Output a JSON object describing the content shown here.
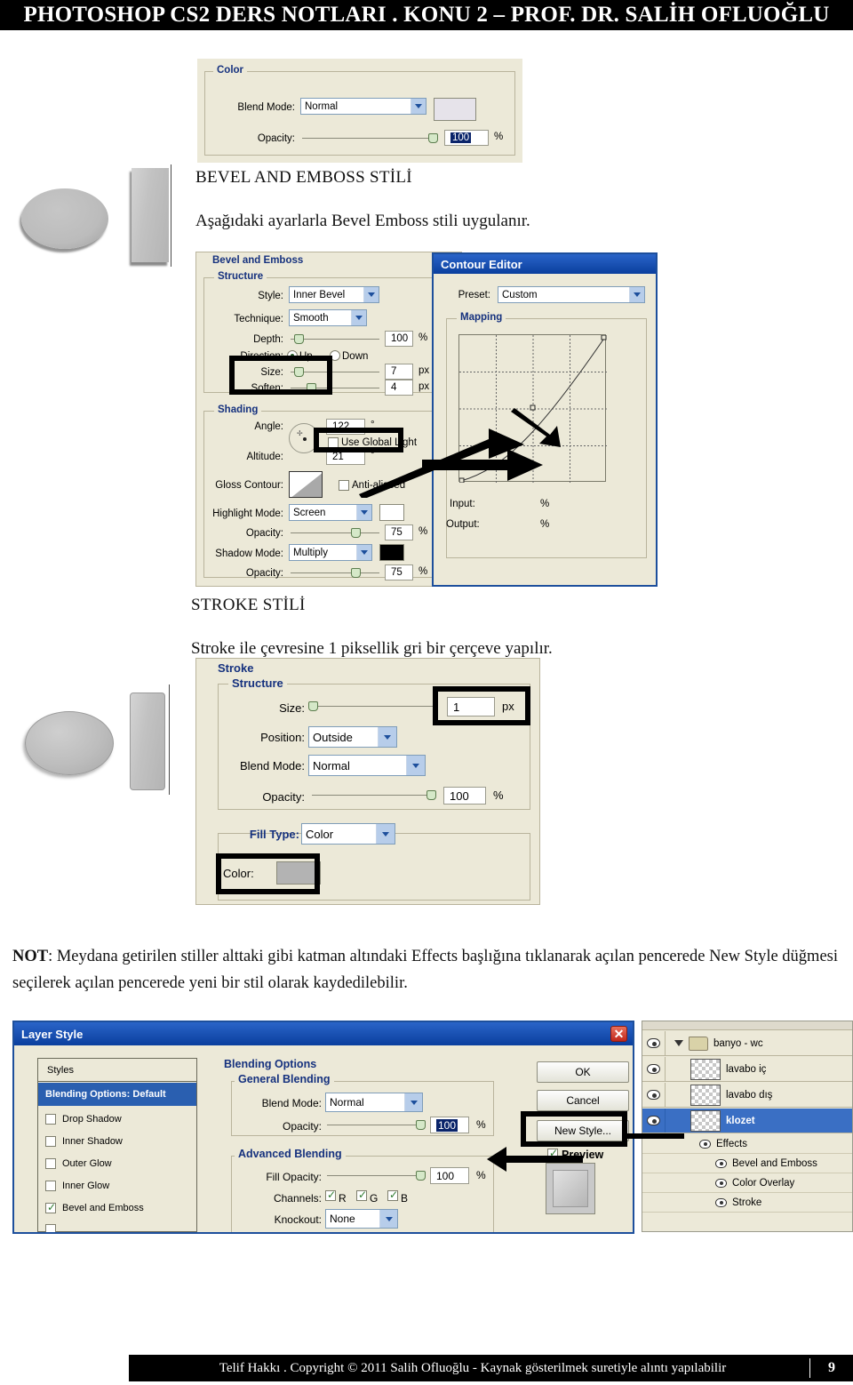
{
  "header": {
    "title": "PHOTOSHOP CS2 DERS NOTLARI . KONU 2 – PROF. DR. SALİH OFLUOĞLU"
  },
  "footer": {
    "copyright": "Telif Hakkı . Copyright © 2011 Salih Ofluoğlu - Kaynak gösterilmek suretiyle alıntı yapılabilir",
    "page": "9"
  },
  "sections": {
    "bevel_heading": "BEVEL AND EMBOSS STİLİ",
    "bevel_body": "Aşağıdaki ayarlarla Bevel Emboss stili uygulanır.",
    "stroke_heading": "STROKE STİLİ",
    "stroke_body": "Stroke ile çevresine 1 piksellik gri bir çerçeve yapılır.",
    "note_bold": "NOT",
    "note_text": ": Meydana getirilen stiller alttaki gibi katman altındaki Effects başlığına tıklanarak açılan pencerede New Style düğmesi seçilerek açılan pencerede yeni bir stil olarak kaydedilebilir."
  },
  "color_panel": {
    "group_label": "Color",
    "blend_mode_label": "Blend Mode:",
    "blend_mode_value": "Normal",
    "opacity_label": "Opacity:",
    "opacity_value": "100",
    "opacity_unit": "%",
    "swatch_color": "#e6e3ea"
  },
  "bevel_panel": {
    "group_label": "Bevel and Emboss",
    "structure_label": "Structure",
    "style_label": "Style:",
    "style_value": "Inner Bevel",
    "technique_label": "Technique:",
    "technique_value": "Smooth",
    "depth_label": "Depth:",
    "depth_value": "100",
    "depth_unit": "%",
    "direction_label": "Direction:",
    "direction_up": "Up",
    "direction_down": "Down",
    "size_label": "Size:",
    "size_value": "7",
    "size_unit": "px",
    "soften_label": "Soften:",
    "soften_value": "4",
    "soften_unit": "px",
    "shading_label": "Shading",
    "angle_label": "Angle:",
    "angle_value": "122",
    "angle_unit": "°",
    "use_global_light": "Use Global Light",
    "altitude_label": "Altitude:",
    "altitude_value": "21",
    "altitude_unit": "°",
    "gloss_contour_label": "Gloss Contour:",
    "anti_aliased": "Anti-aliased",
    "highlight_mode_label": "Highlight Mode:",
    "highlight_mode_value": "Screen",
    "highlight_opacity_label": "Opacity:",
    "highlight_opacity_value": "75",
    "highlight_opacity_unit": "%",
    "highlight_swatch": "#ffffff",
    "shadow_mode_label": "Shadow Mode:",
    "shadow_mode_value": "Multiply",
    "shadow_opacity_label": "Opacity:",
    "shadow_opacity_value": "75",
    "shadow_opacity_unit": "%",
    "shadow_swatch": "#000000"
  },
  "contour_editor": {
    "title": "Contour Editor",
    "preset_label": "Preset:",
    "preset_value": "Custom",
    "mapping_label": "Mapping",
    "input_label": "Input:",
    "input_unit": "%",
    "output_label": "Output:",
    "output_unit": "%"
  },
  "stroke_panel": {
    "group_label": "Stroke",
    "structure_label": "Structure",
    "size_label": "Size:",
    "size_value": "1",
    "size_unit": "px",
    "position_label": "Position:",
    "position_value": "Outside",
    "blend_mode_label": "Blend Mode:",
    "blend_mode_value": "Normal",
    "opacity_label": "Opacity:",
    "opacity_value": "100",
    "opacity_unit": "%",
    "fill_type_label": "Fill Type:",
    "fill_type_value": "Color",
    "color_label": "Color:",
    "color_swatch": "#b3b3b3"
  },
  "layer_style_dialog": {
    "title": "Layer Style",
    "close_glyph": "✕",
    "styles_header": "Styles",
    "styles_items": [
      {
        "label": "Blending Options: Default",
        "selected": true,
        "checkbox": false,
        "checked": false
      },
      {
        "label": "Drop Shadow",
        "selected": false,
        "checkbox": true,
        "checked": false
      },
      {
        "label": "Inner Shadow",
        "selected": false,
        "checkbox": true,
        "checked": false
      },
      {
        "label": "Outer Glow",
        "selected": false,
        "checkbox": true,
        "checked": false
      },
      {
        "label": "Inner Glow",
        "selected": false,
        "checkbox": true,
        "checked": false
      },
      {
        "label": "Bevel and Emboss",
        "selected": false,
        "checkbox": true,
        "checked": true
      }
    ],
    "blending_options_label": "Blending Options",
    "general_blending_label": "General Blending",
    "blend_mode_label": "Blend Mode:",
    "blend_mode_value": "Normal",
    "opacity_label": "Opacity:",
    "opacity_value": "100",
    "opacity_unit": "%",
    "advanced_blending_label": "Advanced Blending",
    "fill_opacity_label": "Fill Opacity:",
    "fill_opacity_value": "100",
    "fill_opacity_unit": "%",
    "channels_label": "Channels:",
    "channel_r": "R",
    "channel_g": "G",
    "channel_b": "B",
    "knockout_label": "Knockout:",
    "knockout_value": "None",
    "buttons": {
      "ok": "OK",
      "cancel": "Cancel",
      "new_style": "New Style...",
      "preview": "Preview"
    }
  },
  "layers_palette": {
    "rows": [
      {
        "name": "banyo - wc",
        "type": "folder",
        "selected": false
      },
      {
        "name": "lavabo iç",
        "type": "layer",
        "selected": false
      },
      {
        "name": "lavabo dış",
        "type": "layer",
        "selected": false
      },
      {
        "name": "klozet",
        "type": "layer",
        "selected": true
      }
    ],
    "effects_label": "Effects",
    "effects": [
      "Bevel and Emboss",
      "Color Overlay",
      "Stroke"
    ]
  }
}
